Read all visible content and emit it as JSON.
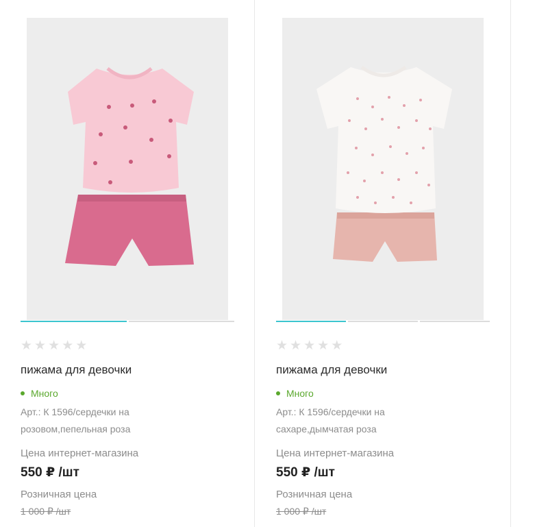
{
  "products": [
    {
      "stars": [
        "★",
        "★",
        "★",
        "★",
        "★"
      ],
      "title": "пижама для девочки",
      "stock": "Много",
      "article": "Арт.: К 1596/сердечки на розовом,пепельная роза",
      "price_label": "Цена интернет-магазина",
      "price": "550 ₽ /шт",
      "retail_label": "Розничная цена",
      "retail_price": "1 000 ₽ /шт",
      "image_colors": {
        "top": "#f8c9d4",
        "shorts": "#d96b8e",
        "pattern": "#c85a7a"
      }
    },
    {
      "stars": [
        "★",
        "★",
        "★",
        "★",
        "★"
      ],
      "title": "пижама для девочки",
      "stock": "Много",
      "article": "Арт.: К 1596/сердечки на сахаре,дымчатая роза",
      "price_label": "Цена интернет-магазина",
      "price": "550 ₽ /шт",
      "retail_label": "Розничная цена",
      "retail_price": "1 000 ₽ /шт",
      "image_colors": {
        "top": "#f9f7f5",
        "shorts": "#e6b5ad",
        "pattern": "#e3a1ab"
      }
    }
  ],
  "colors": {
    "accent": "#3cc5cf",
    "stock": "#5aa82d",
    "muted": "#8c8c8c",
    "star_empty": "#e0e0e0"
  }
}
